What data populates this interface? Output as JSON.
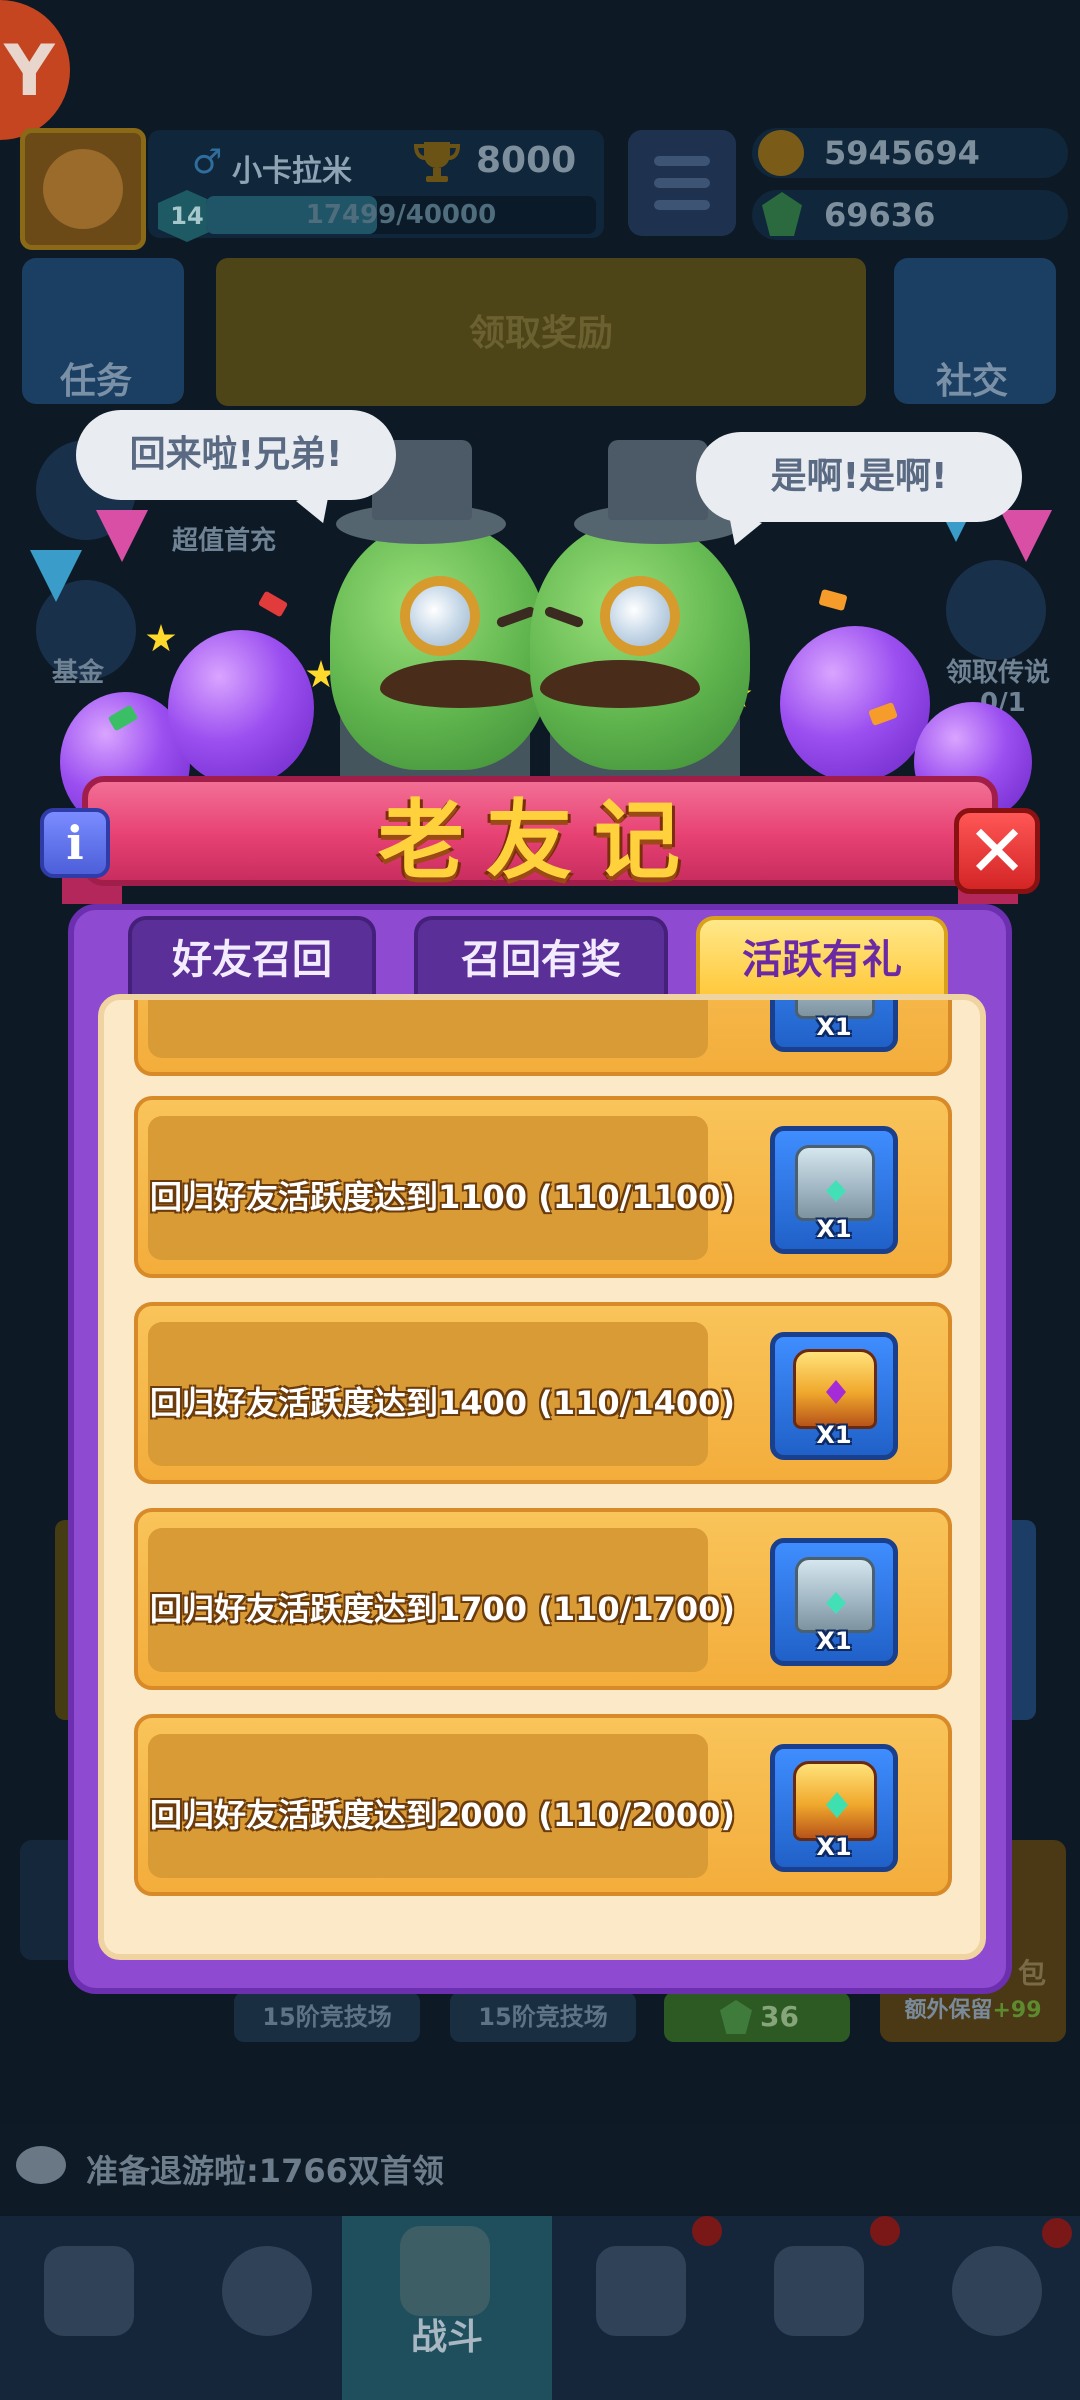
{
  "top_bar": {
    "player_name": "小卡拉米",
    "level": "14",
    "xp_text": "17499/40000",
    "xp_fraction": 0.4375,
    "trophies": "8000",
    "coins": "5945694",
    "gems": "69636"
  },
  "main_buttons": {
    "task_label": "任务",
    "claim_label": "领取奖励",
    "social_label": "社交"
  },
  "side_labels": {
    "left_1": "超值首充",
    "left_2": "基金",
    "right_1": "领取传说",
    "right_1_progress": "0/1"
  },
  "speech": {
    "left": "回来啦!兄弟!",
    "right": "是啊!是啊!"
  },
  "dialog": {
    "title": "老友记",
    "info_label": "i",
    "close_label": "✕",
    "tabs": [
      {
        "label": "好友召回",
        "active": false
      },
      {
        "label": "召回有奖",
        "active": false
      },
      {
        "label": "活跃有礼",
        "active": true
      }
    ],
    "partial_reward_qty": "X1",
    "tasks": [
      {
        "text": "回归好友活跃度达到1100 (110/1100)",
        "reward": "silver-chest",
        "qty": "X1"
      },
      {
        "text": "回归好友活跃度达到1400 (110/1400)",
        "reward": "gold-chest",
        "qty": "X1"
      },
      {
        "text": "回归好友活跃度达到1700 (110/1700)",
        "reward": "silver-chest",
        "qty": "X1"
      },
      {
        "text": "回归好友活跃度达到2000 (110/2000)",
        "reward": "gold-chest",
        "qty": "X1"
      }
    ]
  },
  "lower": {
    "arena_1": "15阶竞技场",
    "arena_2": "15阶竞技场",
    "gem_count": "36",
    "bonus_title": "包",
    "bonus_sub_text": "额外保留",
    "bonus_sub_value": "+99"
  },
  "chat": {
    "message": "准备退游啦:1766双首领"
  },
  "nav": {
    "battle_label": "战斗"
  },
  "colors": {
    "dialog_purple": "#8e4ad0",
    "title_pink": "#e74173",
    "title_gold": "#ffd23d",
    "card_gold": "#f3ad3b",
    "active_tab": "#ffc93c"
  }
}
